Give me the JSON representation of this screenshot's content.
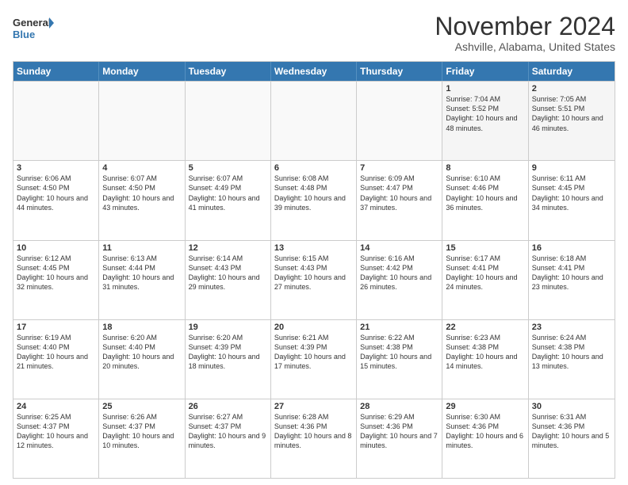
{
  "header": {
    "logo_line1": "General",
    "logo_line2": "Blue",
    "main_title": "November 2024",
    "subtitle": "Ashville, Alabama, United States"
  },
  "days_of_week": [
    "Sunday",
    "Monday",
    "Tuesday",
    "Wednesday",
    "Thursday",
    "Friday",
    "Saturday"
  ],
  "weeks": [
    [
      {
        "day": "",
        "info": "",
        "empty": true
      },
      {
        "day": "",
        "info": "",
        "empty": true
      },
      {
        "day": "",
        "info": "",
        "empty": true
      },
      {
        "day": "",
        "info": "",
        "empty": true
      },
      {
        "day": "",
        "info": "",
        "empty": true
      },
      {
        "day": "1",
        "info": "Sunrise: 7:04 AM\nSunset: 5:52 PM\nDaylight: 10 hours\nand 48 minutes.",
        "empty": false
      },
      {
        "day": "2",
        "info": "Sunrise: 7:05 AM\nSunset: 5:51 PM\nDaylight: 10 hours\nand 46 minutes.",
        "empty": false
      }
    ],
    [
      {
        "day": "3",
        "info": "Sunrise: 6:06 AM\nSunset: 4:50 PM\nDaylight: 10 hours\nand 44 minutes.",
        "empty": false
      },
      {
        "day": "4",
        "info": "Sunrise: 6:07 AM\nSunset: 4:50 PM\nDaylight: 10 hours\nand 43 minutes.",
        "empty": false
      },
      {
        "day": "5",
        "info": "Sunrise: 6:07 AM\nSunset: 4:49 PM\nDaylight: 10 hours\nand 41 minutes.",
        "empty": false
      },
      {
        "day": "6",
        "info": "Sunrise: 6:08 AM\nSunset: 4:48 PM\nDaylight: 10 hours\nand 39 minutes.",
        "empty": false
      },
      {
        "day": "7",
        "info": "Sunrise: 6:09 AM\nSunset: 4:47 PM\nDaylight: 10 hours\nand 37 minutes.",
        "empty": false
      },
      {
        "day": "8",
        "info": "Sunrise: 6:10 AM\nSunset: 4:46 PM\nDaylight: 10 hours\nand 36 minutes.",
        "empty": false
      },
      {
        "day": "9",
        "info": "Sunrise: 6:11 AM\nSunset: 4:45 PM\nDaylight: 10 hours\nand 34 minutes.",
        "empty": false
      }
    ],
    [
      {
        "day": "10",
        "info": "Sunrise: 6:12 AM\nSunset: 4:45 PM\nDaylight: 10 hours\nand 32 minutes.",
        "empty": false
      },
      {
        "day": "11",
        "info": "Sunrise: 6:13 AM\nSunset: 4:44 PM\nDaylight: 10 hours\nand 31 minutes.",
        "empty": false
      },
      {
        "day": "12",
        "info": "Sunrise: 6:14 AM\nSunset: 4:43 PM\nDaylight: 10 hours\nand 29 minutes.",
        "empty": false
      },
      {
        "day": "13",
        "info": "Sunrise: 6:15 AM\nSunset: 4:43 PM\nDaylight: 10 hours\nand 27 minutes.",
        "empty": false
      },
      {
        "day": "14",
        "info": "Sunrise: 6:16 AM\nSunset: 4:42 PM\nDaylight: 10 hours\nand 26 minutes.",
        "empty": false
      },
      {
        "day": "15",
        "info": "Sunrise: 6:17 AM\nSunset: 4:41 PM\nDaylight: 10 hours\nand 24 minutes.",
        "empty": false
      },
      {
        "day": "16",
        "info": "Sunrise: 6:18 AM\nSunset: 4:41 PM\nDaylight: 10 hours\nand 23 minutes.",
        "empty": false
      }
    ],
    [
      {
        "day": "17",
        "info": "Sunrise: 6:19 AM\nSunset: 4:40 PM\nDaylight: 10 hours\nand 21 minutes.",
        "empty": false
      },
      {
        "day": "18",
        "info": "Sunrise: 6:20 AM\nSunset: 4:40 PM\nDaylight: 10 hours\nand 20 minutes.",
        "empty": false
      },
      {
        "day": "19",
        "info": "Sunrise: 6:20 AM\nSunset: 4:39 PM\nDaylight: 10 hours\nand 18 minutes.",
        "empty": false
      },
      {
        "day": "20",
        "info": "Sunrise: 6:21 AM\nSunset: 4:39 PM\nDaylight: 10 hours\nand 17 minutes.",
        "empty": false
      },
      {
        "day": "21",
        "info": "Sunrise: 6:22 AM\nSunset: 4:38 PM\nDaylight: 10 hours\nand 15 minutes.",
        "empty": false
      },
      {
        "day": "22",
        "info": "Sunrise: 6:23 AM\nSunset: 4:38 PM\nDaylight: 10 hours\nand 14 minutes.",
        "empty": false
      },
      {
        "day": "23",
        "info": "Sunrise: 6:24 AM\nSunset: 4:38 PM\nDaylight: 10 hours\nand 13 minutes.",
        "empty": false
      }
    ],
    [
      {
        "day": "24",
        "info": "Sunrise: 6:25 AM\nSunset: 4:37 PM\nDaylight: 10 hours\nand 12 minutes.",
        "empty": false
      },
      {
        "day": "25",
        "info": "Sunrise: 6:26 AM\nSunset: 4:37 PM\nDaylight: 10 hours\nand 10 minutes.",
        "empty": false
      },
      {
        "day": "26",
        "info": "Sunrise: 6:27 AM\nSunset: 4:37 PM\nDaylight: 10 hours\nand 9 minutes.",
        "empty": false
      },
      {
        "day": "27",
        "info": "Sunrise: 6:28 AM\nSunset: 4:36 PM\nDaylight: 10 hours\nand 8 minutes.",
        "empty": false
      },
      {
        "day": "28",
        "info": "Sunrise: 6:29 AM\nSunset: 4:36 PM\nDaylight: 10 hours\nand 7 minutes.",
        "empty": false
      },
      {
        "day": "29",
        "info": "Sunrise: 6:30 AM\nSunset: 4:36 PM\nDaylight: 10 hours\nand 6 minutes.",
        "empty": false
      },
      {
        "day": "30",
        "info": "Sunrise: 6:31 AM\nSunset: 4:36 PM\nDaylight: 10 hours\nand 5 minutes.",
        "empty": false
      }
    ]
  ]
}
